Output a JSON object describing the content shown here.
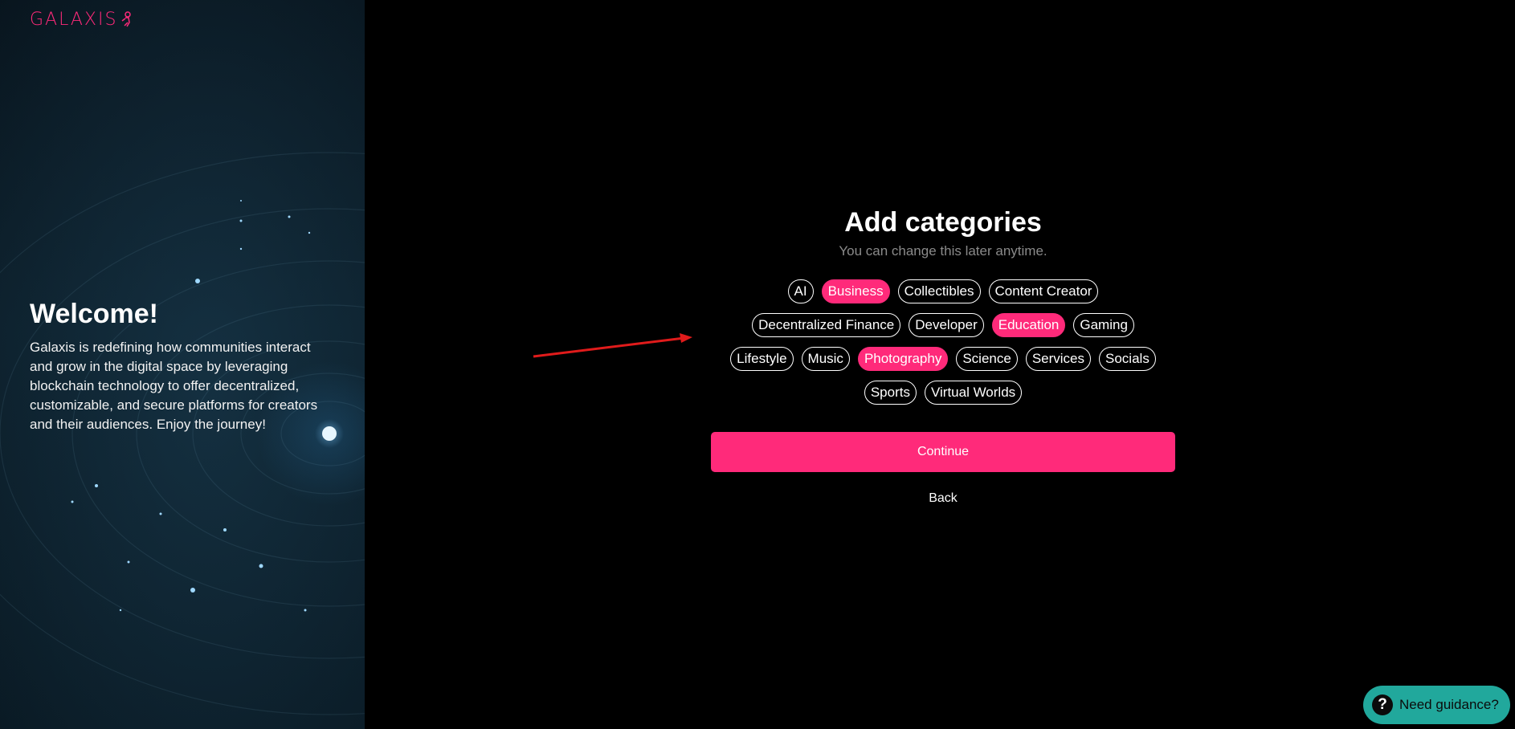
{
  "brand": {
    "name": "GALAXIS",
    "accent_color": "#ff2a7a"
  },
  "welcome": {
    "title": "Welcome!",
    "body": "Galaxis is redefining how communities interact and grow in the digital space by leveraging blockchain technology to offer decentralized, customizable, and secure platforms for creators and their audiences. Enjoy the journey!"
  },
  "main": {
    "title": "Add categories",
    "subtitle": "You can change this later anytime.",
    "category_rows": [
      [
        {
          "label": "AI",
          "selected": false
        },
        {
          "label": "Business",
          "selected": true
        },
        {
          "label": "Collectibles",
          "selected": false
        },
        {
          "label": "Content Creator",
          "selected": false
        }
      ],
      [
        {
          "label": "Decentralized Finance",
          "selected": false
        },
        {
          "label": "Developer",
          "selected": false
        },
        {
          "label": "Education",
          "selected": true
        },
        {
          "label": "Gaming",
          "selected": false
        }
      ],
      [
        {
          "label": "Lifestyle",
          "selected": false
        },
        {
          "label": "Music",
          "selected": false
        },
        {
          "label": "Photography",
          "selected": true
        },
        {
          "label": "Science",
          "selected": false
        },
        {
          "label": "Services",
          "selected": false
        },
        {
          "label": "Socials",
          "selected": false
        }
      ],
      [
        {
          "label": "Sports",
          "selected": false
        },
        {
          "label": "Virtual Worlds",
          "selected": false
        }
      ]
    ],
    "continue_label": "Continue",
    "back_label": "Back"
  },
  "help": {
    "label": "Need guidance?",
    "icon": "question-icon",
    "color": "#21a89c"
  }
}
